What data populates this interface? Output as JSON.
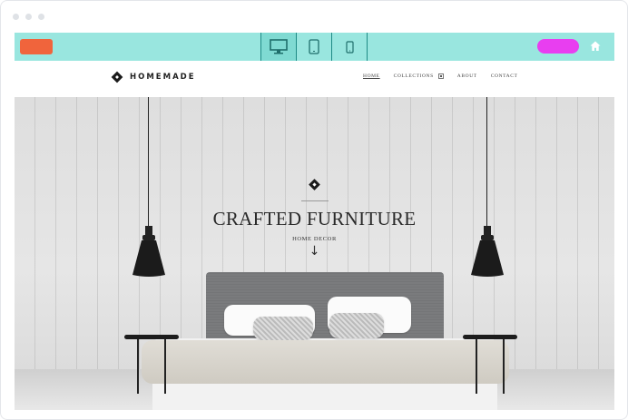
{
  "browser": {
    "dots": [
      "dot",
      "dot",
      "dot"
    ]
  },
  "toolbar": {
    "background": "#99e6df",
    "left_button_color": "#f0643c",
    "right_button_color": "#e83ef0",
    "devices": [
      {
        "name": "desktop-icon",
        "active": true
      },
      {
        "name": "tablet-icon",
        "active": false
      },
      {
        "name": "mobile-icon",
        "active": false
      }
    ],
    "home_icon": "home-icon"
  },
  "nav": {
    "logo_text": "HOMEMADE",
    "menu": [
      {
        "label": "HOME",
        "active": true
      },
      {
        "label": "COLLECTIONS",
        "has_dropdown": true
      },
      {
        "label": "ABOUT"
      },
      {
        "label": "CONTACT"
      }
    ]
  },
  "hero": {
    "title": "CRAFTED FURNITURE",
    "subtitle": "HOME DECOR",
    "arrow": "↓"
  }
}
